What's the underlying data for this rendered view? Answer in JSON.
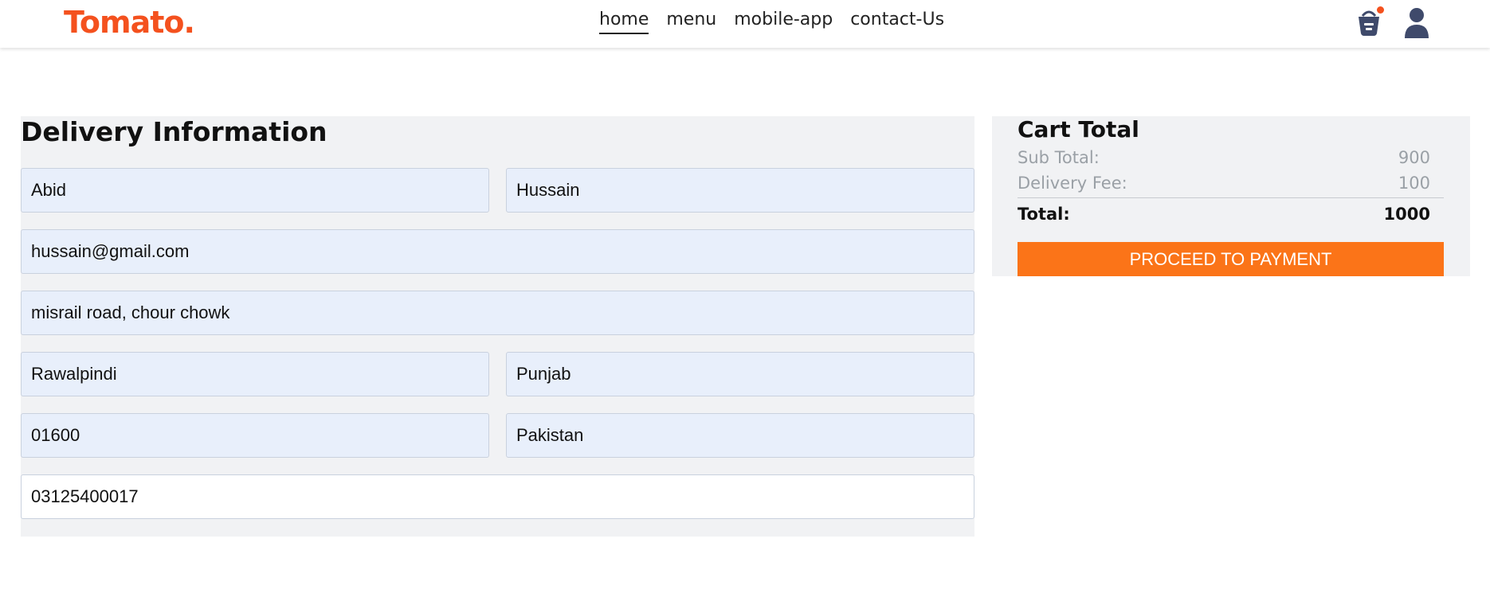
{
  "header": {
    "logo": "Tomato.",
    "nav": [
      "home",
      "menu",
      "mobile-app",
      "contact-Us"
    ],
    "active_nav": "home",
    "icons": [
      "basket-icon",
      "user-icon"
    ],
    "cart_badge_color": "#f4511e"
  },
  "delivery": {
    "title": "Delivery Information",
    "first_name": "Abid",
    "last_name": "Hussain",
    "email": "hussain@gmail.com",
    "street": "misrail road, chour chowk",
    "city": "Rawalpindi",
    "state": "Punjab",
    "zip": "01600",
    "country": "Pakistan",
    "phone": "03125400017"
  },
  "cart": {
    "title": "Cart Total",
    "subtotal_label": "Sub Total:",
    "subtotal_value": "900",
    "delivery_label": "Delivery Fee:",
    "delivery_value": "100",
    "total_label": "Total:",
    "total_value": "1000",
    "button_label": "PROCEED TO PAYMENT",
    "accent_color": "#fb7418"
  }
}
